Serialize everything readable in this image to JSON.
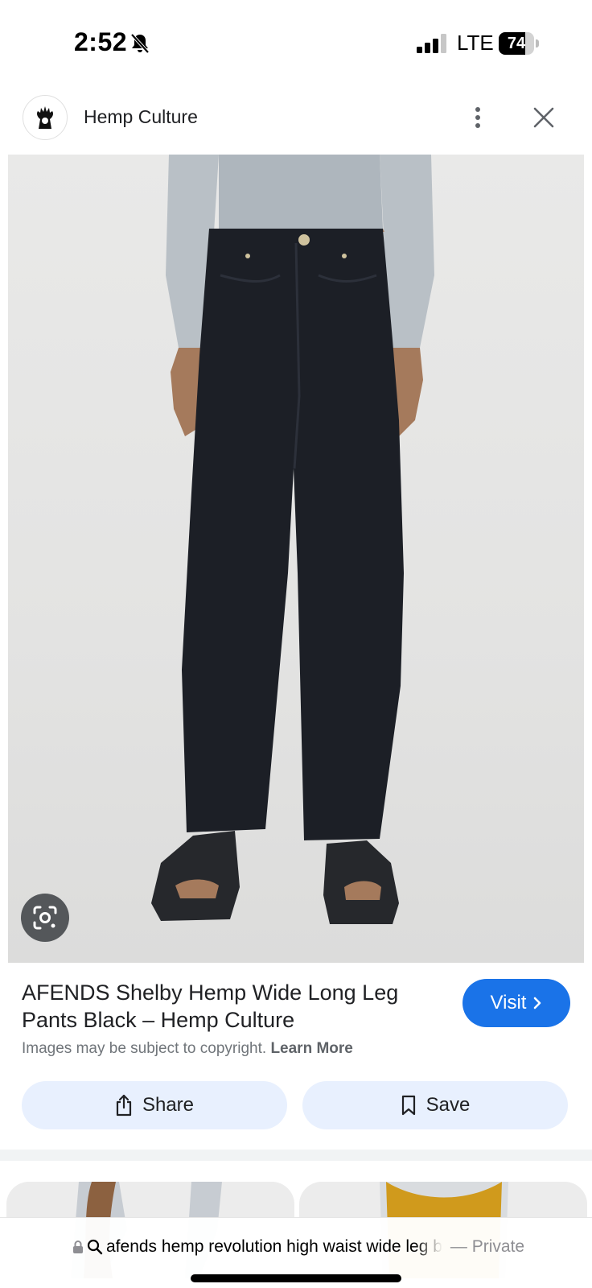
{
  "status_bar": {
    "time": "2:52",
    "network": "LTE",
    "battery_level": "74",
    "battery_fraction": 0.74,
    "icons": [
      "bell-muted-icon",
      "signal-icon",
      "battery-icon"
    ]
  },
  "header": {
    "site_name": "Hemp Culture",
    "icons": [
      "site-logo-icon",
      "more-vert-icon",
      "close-icon"
    ]
  },
  "result": {
    "title": "AFENDS Shelby Hemp Wide Long Leg Pants Black – Hemp Culture",
    "visit_label": "Visit",
    "copyright_text": "Images may be subject to copyright.",
    "learn_more_label": "Learn More"
  },
  "actions": {
    "share_label": "Share",
    "save_label": "Save"
  },
  "browser": {
    "query": "afends hemp revolution high waist wide leg b",
    "private_label": "— Private"
  },
  "colors": {
    "accent": "#1a73e8",
    "action_bg": "#e8f0fe",
    "muted_text": "#70757a"
  }
}
